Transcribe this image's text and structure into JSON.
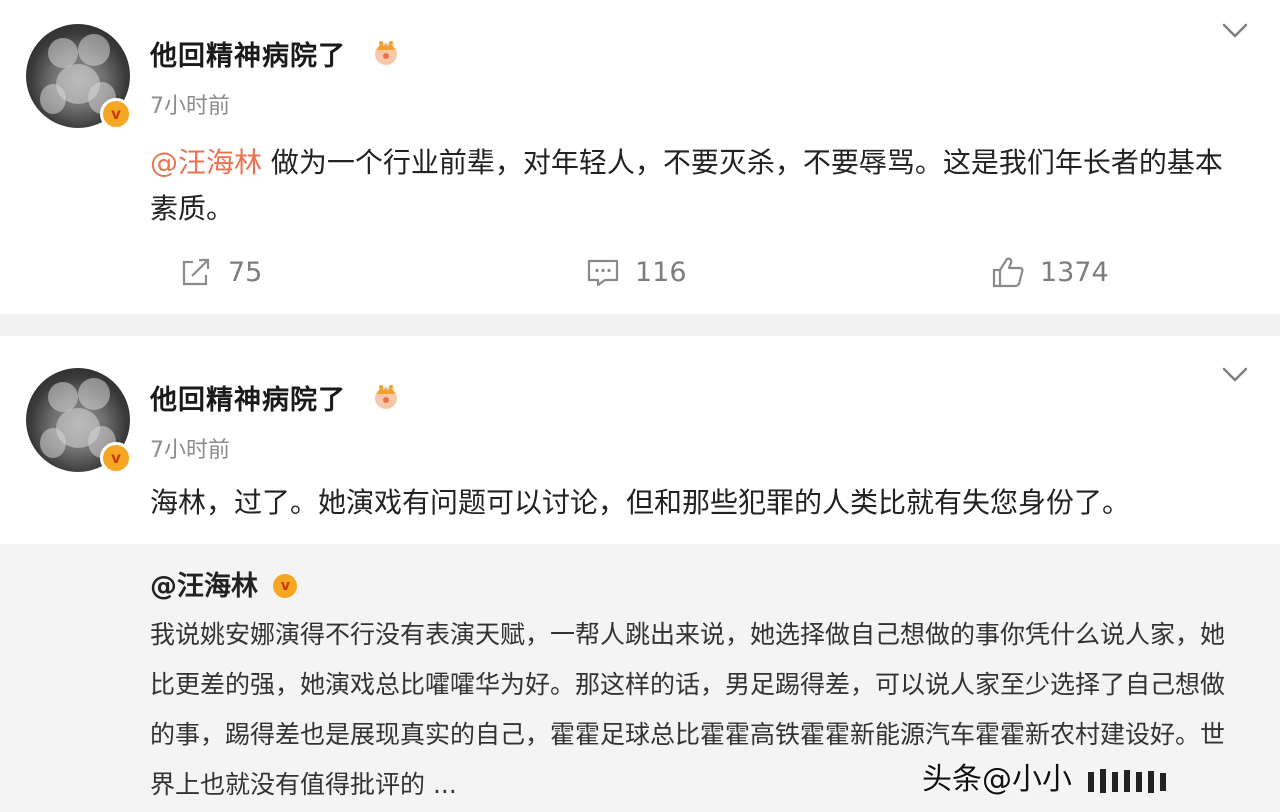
{
  "posts": [
    {
      "username": "他回精神病院了",
      "time": "7小时前",
      "text_mention": "@汪海林",
      "text": " 做为一个行业前辈，对年轻人，不要灭杀，不要辱骂。这是我们年长者的基本素质。",
      "actions": {
        "repost": "75",
        "comment": "116",
        "like": "1374"
      }
    },
    {
      "username": "他回精神病院了",
      "time": "7小时前",
      "text": "海林，过了。她演戏有问题可以讨论，但和那些犯罪的人类比就有失您身份了。",
      "quoted": {
        "username": "@汪海林",
        "text": "我说姚安娜演得不行没有表演天赋，一帮人跳出来说，她选择做自己想做的事你凭什么说人家，她比更差的强，她演戏总比嚯嚯华为好。那这样的话，男足踢得差，可以说人家至少选择了自己想做的事，踢得差也是展现真实的自己，霍霍足球总比霍霍高铁霍霍新能源汽车霍霍新农村建设好。世界上也就没有值得批评的 ..."
      }
    }
  ],
  "watermark": "头条@小小",
  "colors": {
    "mention": "#eb7350",
    "separator": "#f1f1f1",
    "quote_bg": "#f4f4f4"
  },
  "icons": [
    "repost-icon",
    "comment-icon",
    "like-icon",
    "chevron-down-icon",
    "crown-icon",
    "verified-badge-icon"
  ]
}
